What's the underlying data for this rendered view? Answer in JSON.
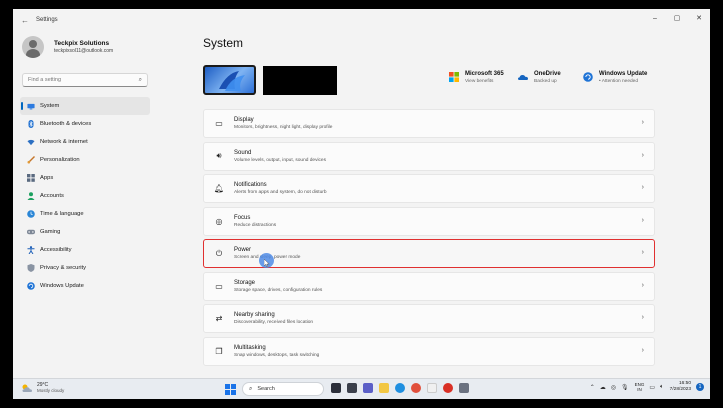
{
  "window": {
    "title": "Settings",
    "back_glyph": "←",
    "minimize_glyph": "–",
    "maximize_glyph": "▢",
    "close_glyph": "✕"
  },
  "profile": {
    "name": "Teckpix Solutions",
    "email": "teckpixsol11@outlook.com"
  },
  "search": {
    "placeholder": "Find a setting",
    "icon": "search-icon"
  },
  "sidebar": {
    "items": [
      {
        "label": "System",
        "icon": "monitor-icon",
        "active": true
      },
      {
        "label": "Bluetooth & devices",
        "icon": "bluetooth-icon"
      },
      {
        "label": "Network & internet",
        "icon": "wifi-icon"
      },
      {
        "label": "Personalization",
        "icon": "brush-icon"
      },
      {
        "label": "Apps",
        "icon": "apps-icon"
      },
      {
        "label": "Accounts",
        "icon": "person-icon"
      },
      {
        "label": "Time & language",
        "icon": "globe-clock-icon"
      },
      {
        "label": "Gaming",
        "icon": "gamepad-icon"
      },
      {
        "label": "Accessibility",
        "icon": "accessibility-icon"
      },
      {
        "label": "Privacy & security",
        "icon": "shield-icon"
      },
      {
        "label": "Windows Update",
        "icon": "update-icon"
      }
    ]
  },
  "page": {
    "title": "System"
  },
  "quick_links": [
    {
      "title": "Microsoft 365",
      "subtitle": "View benefits",
      "icon": "microsoft-365-icon"
    },
    {
      "title": "OneDrive",
      "subtitle": "Backed up",
      "icon": "onedrive-icon"
    },
    {
      "title": "Windows Update",
      "subtitle": "• Attention needed",
      "icon": "windows-update-icon"
    }
  ],
  "cards": [
    {
      "title": "Display",
      "subtitle": "Monitors, brightness, night light, display profile",
      "icon": "display-icon",
      "glyph": "▭"
    },
    {
      "title": "Sound",
      "subtitle": "Volume levels, output, input, sound devices",
      "icon": "speaker-icon",
      "glyph": "🔊︎"
    },
    {
      "title": "Notifications",
      "subtitle": "Alerts from apps and system, do not disturb",
      "icon": "bell-icon",
      "glyph": "🔔︎"
    },
    {
      "title": "Focus",
      "subtitle": "Reduce distractions",
      "icon": "focus-icon",
      "glyph": "◎"
    },
    {
      "title": "Power",
      "subtitle": "Screen and sleep, power mode",
      "icon": "power-icon",
      "glyph": "⏻",
      "highlighted": true
    },
    {
      "title": "Storage",
      "subtitle": "Storage space, drives, configuration rules",
      "icon": "storage-icon",
      "glyph": "▭"
    },
    {
      "title": "Nearby sharing",
      "subtitle": "Discoverability, received files location",
      "icon": "nearby-sharing-icon",
      "glyph": "⇄"
    },
    {
      "title": "Multitasking",
      "subtitle": "Snap windows, desktops, task switching",
      "icon": "multitasking-icon",
      "glyph": "❐"
    }
  ],
  "chevron": "›",
  "taskbar": {
    "weather_temp": "29°C",
    "weather_condition": "Mostly cloudy",
    "search_label": "Search",
    "tray": {
      "lang_top": "ENG",
      "lang_bottom": "IN",
      "time": "16:50",
      "date": "7/28/2023",
      "badge": "1"
    }
  },
  "colors": {
    "accent": "#0067c0",
    "highlight_border": "#e03030"
  }
}
